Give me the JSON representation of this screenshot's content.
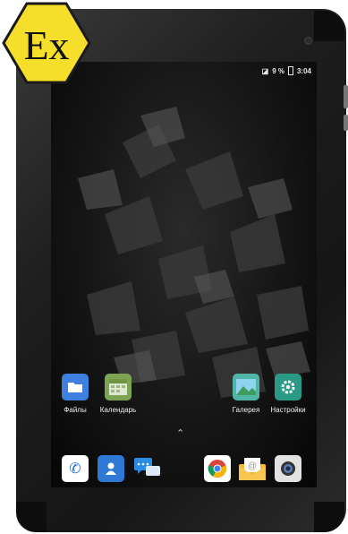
{
  "badge": {
    "text": "Ex",
    "fill": "#f5df2b"
  },
  "status_bar": {
    "battery_percent": "9 %",
    "time": "3:04"
  },
  "home_apps": [
    {
      "label": "Файлы",
      "icon": "folder-icon",
      "color": "#3f7fe0"
    },
    {
      "label": "Календарь",
      "icon": "calendar-icon",
      "color": "#7da452"
    },
    {
      "label": "Галерея",
      "icon": "gallery-icon",
      "color": "#4fb6a6"
    },
    {
      "label": "Настройки",
      "icon": "gear-icon",
      "color": "#2a9a86"
    }
  ],
  "app_drawer_icon": "chevron-up-icon",
  "dock": [
    {
      "icon": "phone-icon",
      "color": "#1d6fd8"
    },
    {
      "icon": "contacts-icon",
      "color": "#2f79d6"
    },
    {
      "icon": "messages-icon",
      "color": "#2b8ce6"
    },
    {
      "icon": "chrome-icon",
      "color": "#ffffff"
    },
    {
      "icon": "email-icon",
      "color": "#f5b82e"
    },
    {
      "icon": "camera-icon",
      "color": "#e2e2e2"
    }
  ]
}
